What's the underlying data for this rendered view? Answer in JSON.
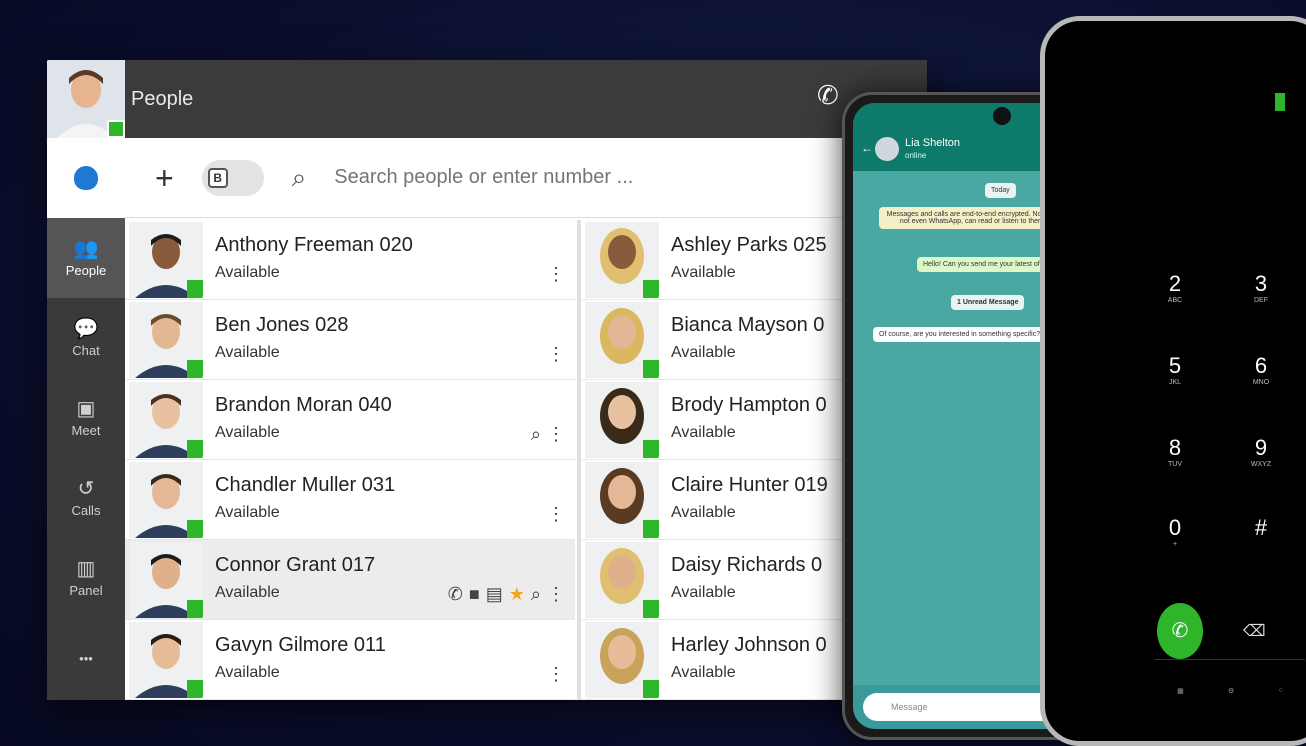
{
  "app": {
    "section_title": "People",
    "search_placeholder": "Search people or enter number ...",
    "toggle_label": "B"
  },
  "rail": [
    {
      "name": "people",
      "label": "People",
      "icon": "people-icon"
    },
    {
      "name": "chat",
      "label": "Chat",
      "icon": "chat-icon"
    },
    {
      "name": "meet",
      "label": "Meet",
      "icon": "meet-icon"
    },
    {
      "name": "calls",
      "label": "Calls",
      "icon": "calls-icon"
    },
    {
      "name": "panel",
      "label": "Panel",
      "icon": "panel-icon"
    }
  ],
  "more_label": "•••",
  "contacts_left": [
    {
      "name": "Anthony Freeman 020",
      "status": "Available"
    },
    {
      "name": "Ben Jones 028",
      "status": "Available"
    },
    {
      "name": "Brandon Moran 040",
      "status": "Available"
    },
    {
      "name": "Chandler Muller 031",
      "status": "Available"
    },
    {
      "name": "Connor Grant 017",
      "status": "Available"
    },
    {
      "name": "Gavyn Gilmore 011",
      "status": "Available"
    }
  ],
  "contacts_right": [
    {
      "name": "Ashley Parks 025",
      "status": "Available"
    },
    {
      "name": "Bianca Mayson 0",
      "status": "Available"
    },
    {
      "name": "Brody Hampton 0",
      "status": "Available"
    },
    {
      "name": "Claire Hunter 019",
      "status": "Available"
    },
    {
      "name": "Daisy Richards 0",
      "status": "Available"
    },
    {
      "name": "Harley Johnson 0",
      "status": "Available"
    }
  ],
  "android": {
    "contact_name": "Lia Shelton",
    "contact_sub": "online",
    "date_label": "Today",
    "system_msg": "Messages and calls are end-to-end encrypted. No one outside of this chat, not even WhatsApp, can read or listen to them. Tap to learn more.",
    "outgoing_msg": "Hello! Can you send me your latest offers?",
    "unread_label": "1 Unread Message",
    "incoming_msg": "Of course, are you interested in something specific?",
    "input_placeholder": "Message"
  },
  "iphone": {
    "keys": [
      {
        "n": "2",
        "l": "ABC"
      },
      {
        "n": "3",
        "l": "DEF"
      },
      {
        "n": "5",
        "l": "JKL"
      },
      {
        "n": "6",
        "l": "MNO"
      },
      {
        "n": "8",
        "l": "TUV"
      },
      {
        "n": "9",
        "l": "WXYZ"
      },
      {
        "n": "0",
        "l": "+"
      },
      {
        "n": "#",
        "l": ""
      }
    ]
  },
  "colors": {
    "available": "#2fb52a",
    "rail": "#3a3a3c",
    "topbar": "#3b3b3d",
    "whatsapp": "#0e7a6b"
  }
}
